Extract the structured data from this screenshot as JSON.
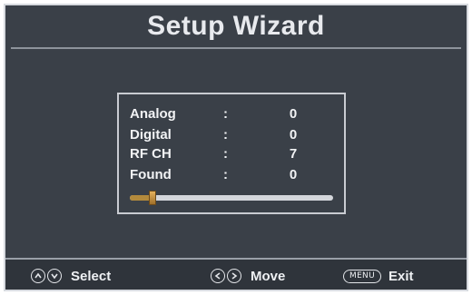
{
  "title": "Setup Wizard",
  "scan": {
    "rows": [
      {
        "label": "Analog",
        "separator": ":",
        "value": "0"
      },
      {
        "label": "Digital",
        "separator": ":",
        "value": "0"
      },
      {
        "label": "RF CH",
        "separator": ":",
        "value": "7"
      },
      {
        "label": "Found",
        "separator": ":",
        "value": "0"
      }
    ],
    "progress_fraction": 0.11
  },
  "footer": {
    "select": {
      "icons": [
        "up-icon",
        "down-icon"
      ],
      "label": "Select"
    },
    "move": {
      "icons": [
        "left-icon",
        "right-icon"
      ],
      "label": "Move"
    },
    "exit": {
      "key": "MENU",
      "label": "Exit"
    }
  },
  "colors": {
    "background": "#3a4048",
    "accent": "#b38a3c",
    "text": "#eef0f3"
  }
}
